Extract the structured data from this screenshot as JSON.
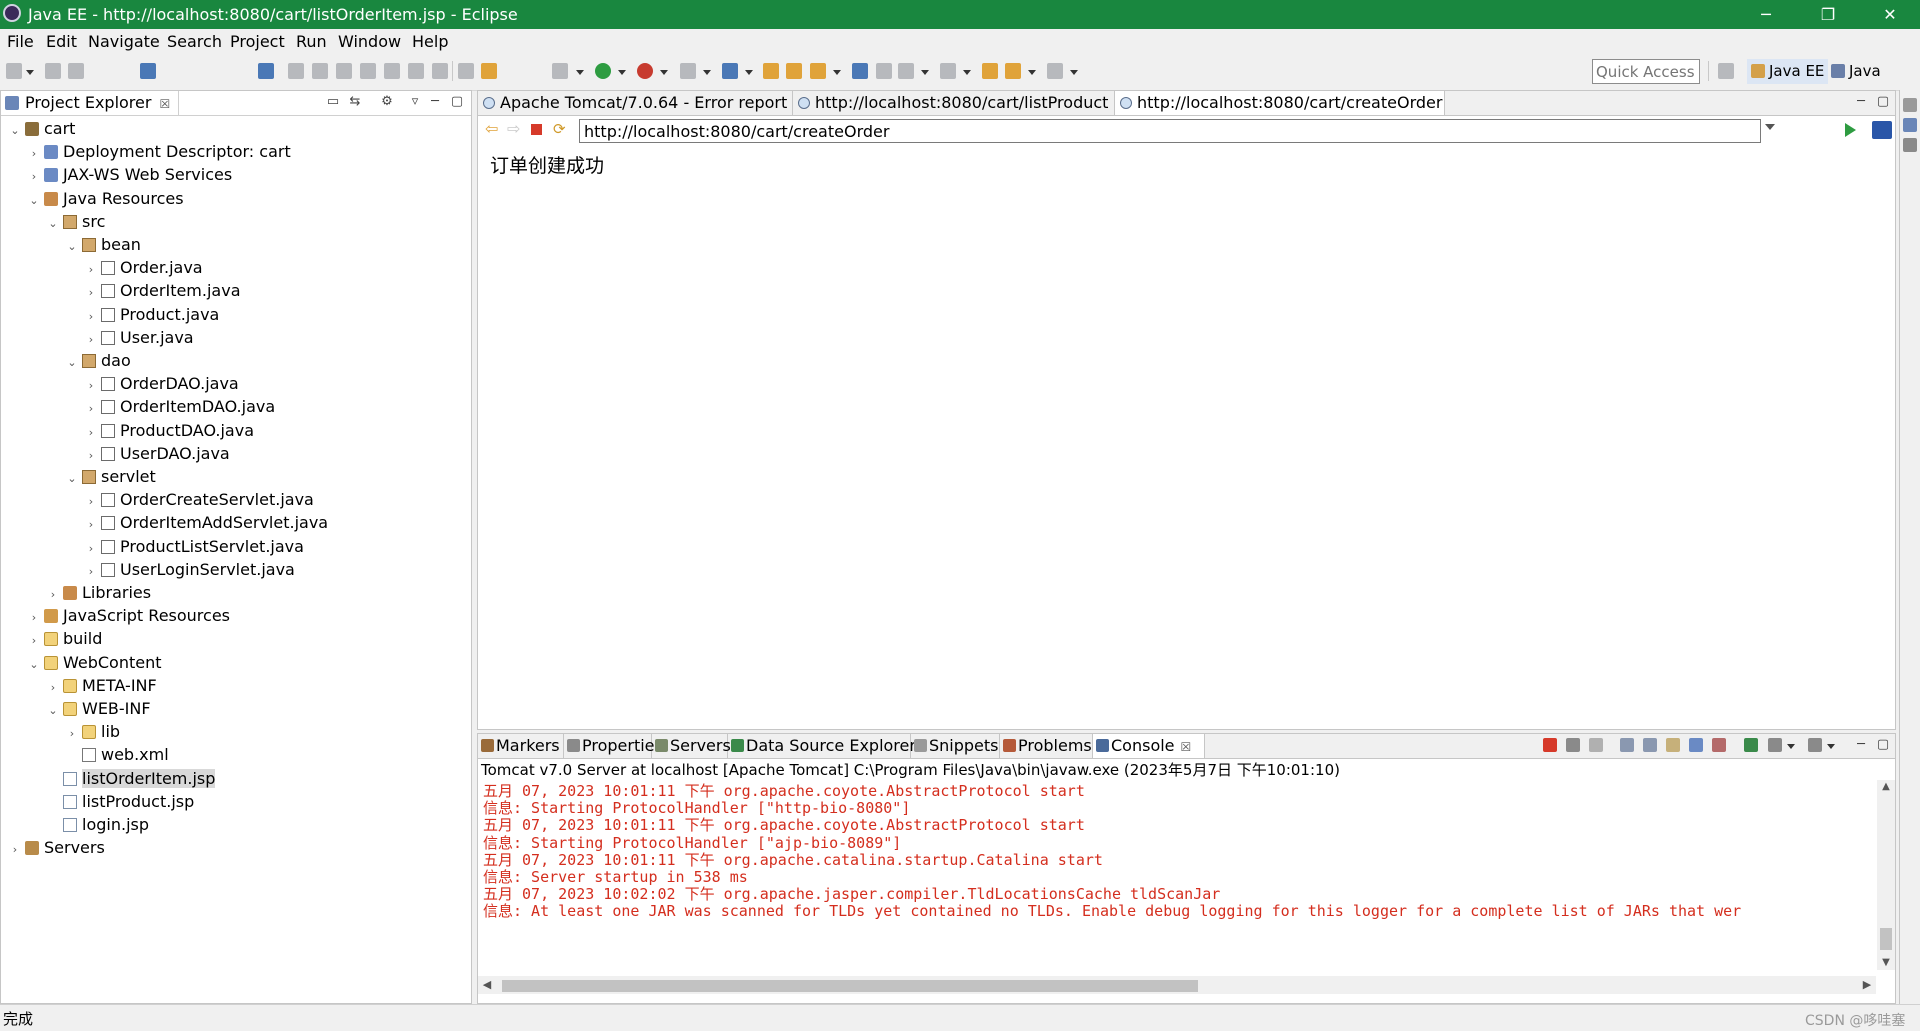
{
  "window": {
    "title": "Java EE - http://localhost:8080/cart/listOrderItem.jsp - Eclipse",
    "minimize": "─",
    "restore": "❐",
    "close": "✕"
  },
  "menu": [
    "File",
    "Edit",
    "Navigate",
    "Search",
    "Project",
    "Run",
    "Window",
    "Help"
  ],
  "toolbar": {
    "quick_access_placeholder": "Quick Access",
    "perspectives": [
      "Java EE",
      "Java"
    ]
  },
  "explorer": {
    "tab_label": "Project Explorer",
    "tab_close": "☒",
    "tree": [
      {
        "label": "cart",
        "depth": 0,
        "twisty": "v",
        "icon": "project"
      },
      {
        "label": "Deployment Descriptor: cart",
        "depth": 1,
        "twisty": ">",
        "icon": "desc"
      },
      {
        "label": "JAX-WS Web Services",
        "depth": 1,
        "twisty": ">",
        "icon": "desc"
      },
      {
        "label": "Java Resources",
        "depth": 1,
        "twisty": "v",
        "icon": "lib"
      },
      {
        "label": "src",
        "depth": 2,
        "twisty": "v",
        "icon": "package"
      },
      {
        "label": "bean",
        "depth": 3,
        "twisty": "v",
        "icon": "package"
      },
      {
        "label": "Order.java",
        "depth": 4,
        "twisty": ">",
        "icon": "java"
      },
      {
        "label": "OrderItem.java",
        "depth": 4,
        "twisty": ">",
        "icon": "java"
      },
      {
        "label": "Product.java",
        "depth": 4,
        "twisty": ">",
        "icon": "java"
      },
      {
        "label": "User.java",
        "depth": 4,
        "twisty": ">",
        "icon": "java"
      },
      {
        "label": "dao",
        "depth": 3,
        "twisty": "v",
        "icon": "package"
      },
      {
        "label": "OrderDAO.java",
        "depth": 4,
        "twisty": ">",
        "icon": "java"
      },
      {
        "label": "OrderItemDAO.java",
        "depth": 4,
        "twisty": ">",
        "icon": "java"
      },
      {
        "label": "ProductDAO.java",
        "depth": 4,
        "twisty": ">",
        "icon": "java"
      },
      {
        "label": "UserDAO.java",
        "depth": 4,
        "twisty": ">",
        "icon": "java"
      },
      {
        "label": "servlet",
        "depth": 3,
        "twisty": "v",
        "icon": "package"
      },
      {
        "label": "OrderCreateServlet.java",
        "depth": 4,
        "twisty": ">",
        "icon": "java"
      },
      {
        "label": "OrderItemAddServlet.java",
        "depth": 4,
        "twisty": ">",
        "icon": "java"
      },
      {
        "label": "ProductListServlet.java",
        "depth": 4,
        "twisty": ">",
        "icon": "java"
      },
      {
        "label": "UserLoginServlet.java",
        "depth": 4,
        "twisty": ">",
        "icon": "java"
      },
      {
        "label": "Libraries",
        "depth": 2,
        "twisty": ">",
        "icon": "lib"
      },
      {
        "label": "JavaScript Resources",
        "depth": 1,
        "twisty": ">",
        "icon": "js"
      },
      {
        "label": "build",
        "depth": 1,
        "twisty": ">",
        "icon": "folder"
      },
      {
        "label": "WebContent",
        "depth": 1,
        "twisty": "v",
        "icon": "folder"
      },
      {
        "label": "META-INF",
        "depth": 2,
        "twisty": ">",
        "icon": "folder"
      },
      {
        "label": "WEB-INF",
        "depth": 2,
        "twisty": "v",
        "icon": "folder"
      },
      {
        "label": "lib",
        "depth": 3,
        "twisty": ">",
        "icon": "folder"
      },
      {
        "label": "web.xml",
        "depth": 3,
        "twisty": "",
        "icon": "xml"
      },
      {
        "label": "listOrderItem.jsp",
        "depth": 2,
        "twisty": "",
        "icon": "jsp",
        "selected": true
      },
      {
        "label": "listProduct.jsp",
        "depth": 2,
        "twisty": "",
        "icon": "jsp"
      },
      {
        "label": "login.jsp",
        "depth": 2,
        "twisty": "",
        "icon": "jsp"
      },
      {
        "label": "Servers",
        "depth": 0,
        "twisty": ">",
        "icon": "server"
      }
    ]
  },
  "editor": {
    "tabs": [
      {
        "label": "Apache Tomcat/7.0.64 - Error report",
        "active": false
      },
      {
        "label": "http://localhost:8080/cart/listProduct",
        "active": false
      },
      {
        "label": "http://localhost:8080/cart/createOrder",
        "active": true
      }
    ],
    "tab_close": "☒",
    "url": "http://localhost:8080/cart/createOrder",
    "page_text": "订单创建成功"
  },
  "console": {
    "tabs": [
      "Markers",
      "Properties",
      "Servers",
      "Data Source Explorer",
      "Snippets",
      "Problems",
      "Console"
    ],
    "active_tab": "Console",
    "tab_close": "☒",
    "description": "Tomcat v7.0 Server at localhost [Apache Tomcat] C:\\Program Files\\Java\\bin\\javaw.exe (2023年5月7日 下午10:01:10)",
    "log_color": "#d42e1e",
    "lines": [
      "五月 07, 2023 10:01:11 下午 org.apache.coyote.AbstractProtocol start",
      "信息: Starting ProtocolHandler [\"http-bio-8080\"]",
      "五月 07, 2023 10:01:11 下午 org.apache.coyote.AbstractProtocol start",
      "信息: Starting ProtocolHandler [\"ajp-bio-8089\"]",
      "五月 07, 2023 10:01:11 下午 org.apache.catalina.startup.Catalina start",
      "信息: Server startup in 538 ms",
      "五月 07, 2023 10:02:02 下午 org.apache.jasper.compiler.TldLocationsCache tldScanJar",
      "信息: At least one JAR was scanned for TLDs yet contained no TLDs. Enable debug logging for this logger for a complete list of JARs that wer"
    ]
  },
  "status": {
    "text": "完成",
    "watermark": "CSDN @哆哇塞"
  },
  "colors": {
    "titlebar": "#19873f",
    "selection": "#d9d9d9"
  }
}
